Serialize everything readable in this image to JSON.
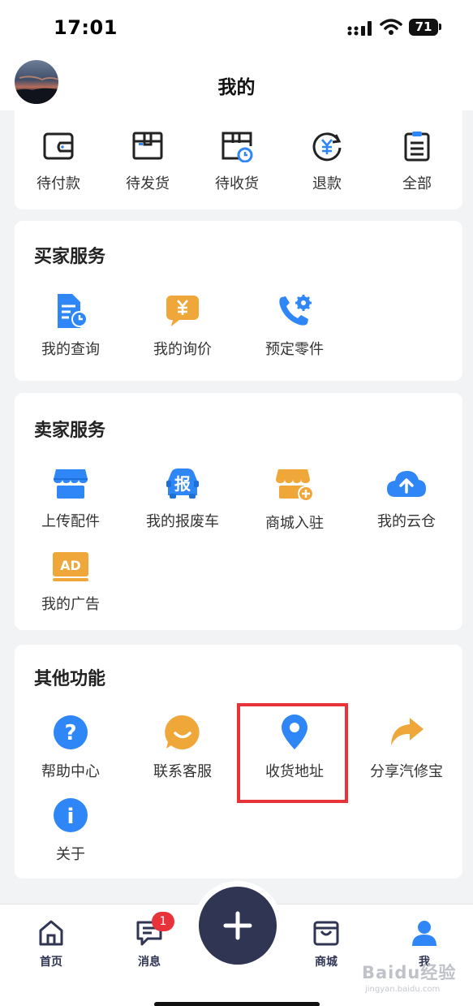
{
  "status_bar": {
    "time": "17:01",
    "battery": "71"
  },
  "header": {
    "title": "我的"
  },
  "orders": {
    "items": [
      {
        "label": "待付款",
        "icon": "wallet-icon"
      },
      {
        "label": "待发货",
        "icon": "package-icon"
      },
      {
        "label": "待收货",
        "icon": "delivery-clock-icon"
      },
      {
        "label": "退款",
        "icon": "refund-icon"
      },
      {
        "label": "全部",
        "icon": "clipboard-list-icon"
      }
    ]
  },
  "buyer": {
    "title": "买家服务",
    "items": [
      {
        "label": "我的查询",
        "icon": "document-clock-icon"
      },
      {
        "label": "我的询价",
        "icon": "yuan-chat-icon"
      },
      {
        "label": "预定零件",
        "icon": "phone-gear-icon"
      }
    ]
  },
  "seller": {
    "title": "卖家服务",
    "items": [
      {
        "label": "上传配件",
        "icon": "store-icon"
      },
      {
        "label": "我的报废车",
        "icon": "scrap-car-icon",
        "glyph": "报"
      },
      {
        "label": "商城入驻",
        "icon": "store-add-icon"
      },
      {
        "label": "我的云仓",
        "icon": "cloud-upload-icon"
      },
      {
        "label": "我的广告",
        "icon": "ad-icon",
        "glyph": "AD"
      }
    ]
  },
  "other": {
    "title": "其他功能",
    "items": [
      {
        "label": "帮助中心",
        "icon": "help-icon",
        "glyph": "?"
      },
      {
        "label": "联系客服",
        "icon": "chat-smile-icon"
      },
      {
        "label": "收货地址",
        "icon": "location-pin-icon"
      },
      {
        "label": "分享汽修宝",
        "icon": "share-arrow-icon"
      },
      {
        "label": "关于",
        "icon": "info-icon",
        "glyph": "i"
      }
    ]
  },
  "tabbar": {
    "tabs": [
      {
        "label": "首页",
        "icon": "home-icon"
      },
      {
        "label": "消息",
        "icon": "message-icon",
        "badge": "1"
      },
      {
        "label": "商城",
        "icon": "shopping-bag-icon"
      },
      {
        "label": "我",
        "icon": "user-icon"
      }
    ],
    "active": "我"
  },
  "watermark": {
    "brand": "Baidu经验",
    "url": "jingyan.baidu.com"
  },
  "colors": {
    "blue": "#2f86f6",
    "orange": "#f0a73a",
    "navy": "#2f3553",
    "red": "#e8333a"
  }
}
